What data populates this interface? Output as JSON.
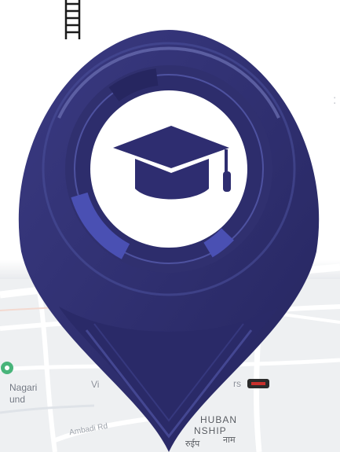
{
  "colors": {
    "pin_dark": "#2d2c6f",
    "pin_mid": "#33337a",
    "ring_light": "#5257a3",
    "accent_blue": "#4a50b3",
    "cap": "#2e2d70",
    "map_base": "#eef0f2",
    "map_road": "#ffffff",
    "map_marker": "#48b47a"
  },
  "icons": {
    "pin": "location-pin-icon",
    "graduation": "graduation-cap-icon",
    "map_marker": "map-marker-icon",
    "ladder": "ladder-icon"
  },
  "map": {
    "labels": {
      "nagari": "Nagari",
      "und": "und",
      "vi": "Vi",
      "rs": "rs",
      "road": "Ambadi Rd",
      "hubhan": "HUBAN",
      "nship": "NSHIP",
      "hindi": "रुईप",
      "hin2": "नाम",
      "dots": ":"
    }
  }
}
